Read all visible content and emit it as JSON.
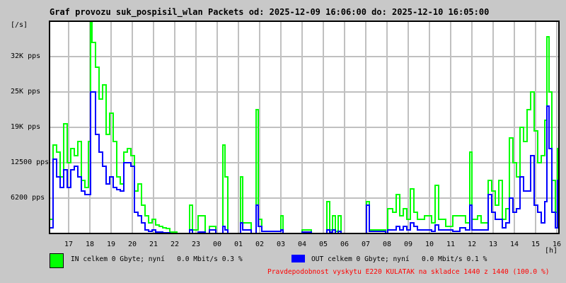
{
  "chart_data": {
    "type": "line",
    "title": "Graf provozu suk_pospisil_wlan Packets od: 2025-12-09 16:06:00 do: 2025-12-10 16:05:00",
    "ylabel": "[/s]",
    "xlabel": "[h]",
    "x_units": "minutes since 2025-12-09 16:06",
    "xlim": [
      0,
      1440
    ],
    "ylim": [
      0,
      37500
    ],
    "grid": true,
    "y_ticks": [
      {
        "value": 6250,
        "label": "6200 pps"
      },
      {
        "value": 12500,
        "label": "12500 pps"
      },
      {
        "value": 18750,
        "label": "19K pps"
      },
      {
        "value": 25000,
        "label": "25K pps"
      },
      {
        "value": 31250,
        "label": "32K pps"
      }
    ],
    "x_ticks": [
      {
        "value": 54,
        "label": "17"
      },
      {
        "value": 114,
        "label": "18"
      },
      {
        "value": 174,
        "label": "19"
      },
      {
        "value": 234,
        "label": "20"
      },
      {
        "value": 294,
        "label": "21"
      },
      {
        "value": 354,
        "label": "22"
      },
      {
        "value": 414,
        "label": "23"
      },
      {
        "value": 474,
        "label": "00"
      },
      {
        "value": 534,
        "label": "01"
      },
      {
        "value": 594,
        "label": "02"
      },
      {
        "value": 654,
        "label": "03"
      },
      {
        "value": 714,
        "label": "04"
      },
      {
        "value": 774,
        "label": "05"
      },
      {
        "value": 834,
        "label": "06"
      },
      {
        "value": 894,
        "label": "07"
      },
      {
        "value": 954,
        "label": "08"
      },
      {
        "value": 1014,
        "label": "09"
      },
      {
        "value": 1074,
        "label": "10"
      },
      {
        "value": 1134,
        "label": "11"
      },
      {
        "value": 1194,
        "label": "12"
      },
      {
        "value": 1254,
        "label": "13"
      },
      {
        "value": 1314,
        "label": "14"
      },
      {
        "value": 1374,
        "label": "15"
      },
      {
        "value": 1434,
        "label": "16"
      }
    ],
    "x": [
      0,
      10,
      20,
      30,
      40,
      50,
      60,
      70,
      80,
      90,
      100,
      110,
      116,
      120,
      130,
      140,
      150,
      160,
      170,
      180,
      190,
      200,
      210,
      220,
      230,
      240,
      250,
      260,
      270,
      280,
      290,
      300,
      310,
      320,
      330,
      340,
      360,
      396,
      404,
      420,
      440,
      452,
      470,
      486,
      490,
      496,
      504,
      536,
      540,
      546,
      570,
      584,
      590,
      600,
      654,
      660,
      714,
      740,
      784,
      792,
      800,
      808,
      816,
      824,
      860,
      896,
      904,
      950,
      956,
      970,
      980,
      990,
      1000,
      1010,
      1020,
      1030,
      1040,
      1060,
      1080,
      1090,
      1100,
      1120,
      1140,
      1160,
      1176,
      1188,
      1194,
      1210,
      1220,
      1240,
      1250,
      1260,
      1270,
      1280,
      1290,
      1300,
      1310,
      1320,
      1330,
      1340,
      1350,
      1360,
      1370,
      1380,
      1390,
      1400,
      1406,
      1412,
      1420,
      1430,
      1436,
      1440
    ],
    "series": [
      {
        "name": "IN",
        "color": "#00ff00",
        "values": [
          2500,
          15625,
          14375,
          10000,
          19375,
          12500,
          15000,
          13750,
          16250,
          9375,
          8125,
          16250,
          37500,
          33750,
          29375,
          23750,
          26250,
          17500,
          21250,
          16250,
          10000,
          8750,
          14375,
          15000,
          13750,
          7500,
          8750,
          5000,
          3125,
          1875,
          2500,
          1500,
          1250,
          1000,
          875,
          250,
          0,
          5000,
          625,
          3125,
          0,
          1250,
          0,
          0,
          15625,
          10000,
          0,
          0,
          10000,
          1875,
          0,
          21875,
          2500,
          375,
          3125,
          0,
          625,
          0,
          5625,
          625,
          3125,
          375,
          3125,
          0,
          0,
          5625,
          625,
          0,
          4375,
          3750,
          6875,
          3125,
          4375,
          2500,
          7875,
          3750,
          2500,
          3125,
          1875,
          8500,
          2500,
          1250,
          3125,
          3125,
          1875,
          14375,
          2500,
          3125,
          1875,
          9375,
          7500,
          5000,
          9375,
          2500,
          4375,
          16875,
          12500,
          10000,
          18750,
          16250,
          21875,
          25000,
          18125,
          12500,
          13750,
          20000,
          34750,
          25000,
          9375,
          3750,
          15000,
          10000
        ]
      },
      {
        "name": "OUT",
        "color": "#0000ff",
        "values": [
          1000,
          13125,
          10000,
          8125,
          11250,
          8125,
          11250,
          11875,
          10000,
          7500,
          6875,
          6875,
          25000,
          25000,
          17500,
          14375,
          11875,
          8750,
          10000,
          8125,
          7750,
          7500,
          12500,
          12500,
          11875,
          3750,
          3125,
          1875,
          625,
          375,
          625,
          250,
          250,
          125,
          125,
          0,
          0,
          625,
          0,
          250,
          0,
          625,
          0,
          0,
          1250,
          625,
          0,
          0,
          1875,
          625,
          0,
          5000,
          1250,
          375,
          625,
          0,
          250,
          0,
          625,
          250,
          625,
          0,
          375,
          0,
          0,
          5000,
          375,
          0,
          625,
          625,
          1250,
          625,
          1250,
          625,
          1875,
          1250,
          625,
          625,
          375,
          1500,
          625,
          625,
          375,
          1000,
          625,
          5000,
          625,
          625,
          625,
          6875,
          3750,
          2500,
          2500,
          1000,
          1875,
          6250,
          3750,
          4375,
          10000,
          7500,
          7500,
          13750,
          5000,
          3750,
          1875,
          5625,
          22500,
          15000,
          3750,
          1000,
          9375,
          5000
        ]
      }
    ]
  },
  "legend": {
    "in_text": "IN celkem 0 Gbyte; nyní   0.0 Mbit/s 0.3 %",
    "out_text": "OUT celkem 0 Gbyte; nyní   0.0 Mbit/s 0.1 %",
    "in_color": "#00ff00",
    "out_color": "#0000ff",
    "note": "Pravdepodobnost vyskytu E220 KULATAK na skladce 1440 z 1440 (100.0 %)",
    "note_color": "#ff0000"
  }
}
